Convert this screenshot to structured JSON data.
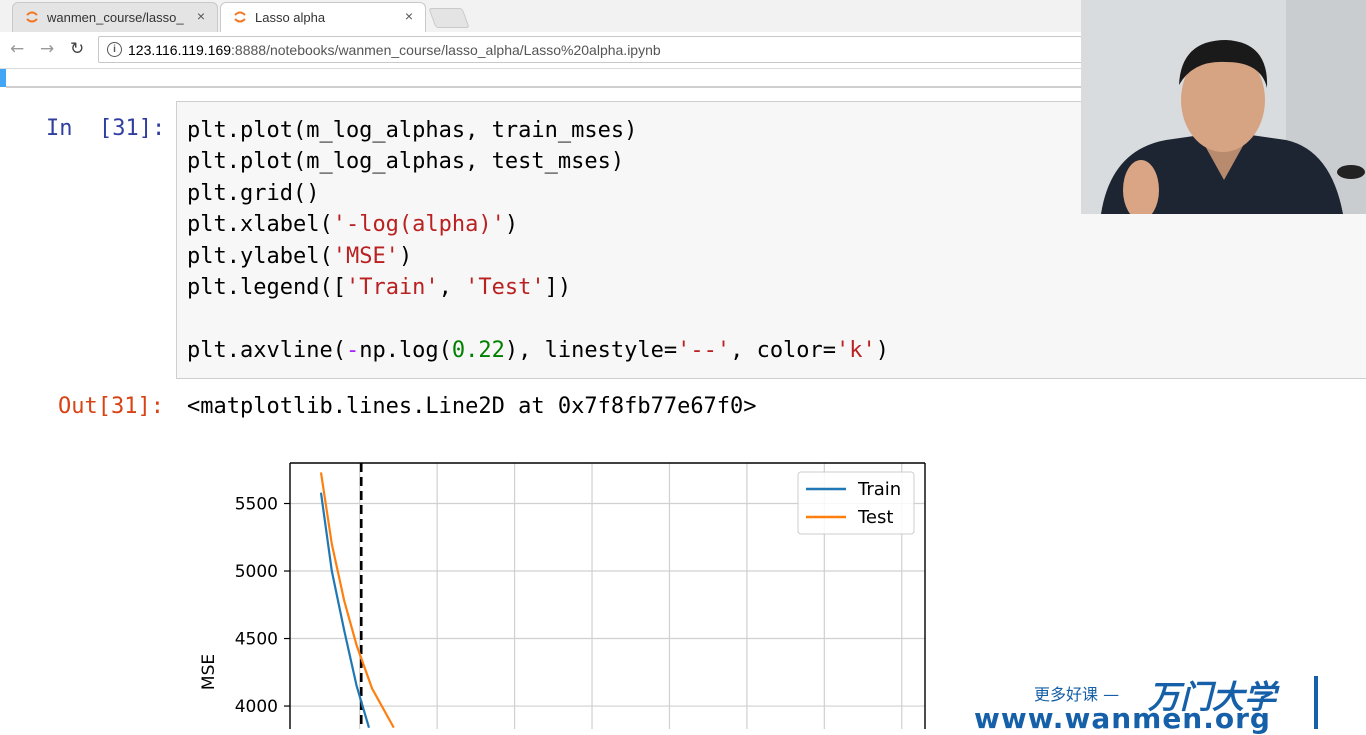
{
  "browser": {
    "tabs": [
      {
        "title": "wanmen_course/lasso_",
        "active": false
      },
      {
        "title": "Lasso alpha",
        "active": true
      }
    ],
    "close_glyph": "×",
    "url_host": "123.116.119.169",
    "url_rest": ":8888/notebooks/wanmen_course/lasso_alpha/Lasso%20alpha.ipynb",
    "nav": {
      "back": "←",
      "forward": "→",
      "reload": "↻"
    }
  },
  "cell": {
    "in_prompt": "In  [31]:",
    "out_prompt": "Out[31]:",
    "output_text": "<matplotlib.lines.Line2D at 0x7f8fb77e67f0>",
    "code": {
      "line1": "plt.plot(m_log_alphas, train_mses)",
      "line2": "plt.plot(m_log_alphas, test_mses)",
      "line3": "plt.grid()",
      "line4_pre": "plt.xlabel(",
      "line4_str": "'-log(alpha)'",
      "line4_post": ")",
      "line5_pre": "plt.ylabel(",
      "line5_str": "'MSE'",
      "line5_post": ")",
      "line6_pre": "plt.legend([",
      "line6_str1": "'Train'",
      "line6_sep": ", ",
      "line6_str2": "'Test'",
      "line6_post": "])",
      "line8_pre": "plt.axvline(",
      "line8_minus": "-",
      "line8_mid": "np.log(",
      "line8_num": "0.22",
      "line8_mid2": "), linestyle=",
      "line8_str1": "'--'",
      "line8_mid3": ", color=",
      "line8_str2": "'k'",
      "line8_post": ")"
    }
  },
  "chart_data": {
    "type": "line",
    "xlabel": "",
    "ylabel": "MSE",
    "ylim_visible": [
      3830,
      5800
    ],
    "yticks": [
      4000,
      4500,
      5000,
      5500
    ],
    "grid": true,
    "legend_position": "top-right",
    "axvline": {
      "x": 1.51,
      "style": "dashed",
      "color": "#000000"
    },
    "xlim": [
      1.05,
      5.15
    ],
    "series": [
      {
        "name": "Train",
        "color": "#1f77b4",
        "x": [
          1.25,
          1.32,
          1.4,
          1.48,
          1.56
        ],
        "y": [
          5580,
          5000,
          4560,
          4150,
          3840
        ]
      },
      {
        "name": "Test",
        "color": "#ff7f0e",
        "x": [
          1.25,
          1.32,
          1.4,
          1.48,
          1.58,
          1.72
        ],
        "y": [
          5730,
          5200,
          4780,
          4450,
          4130,
          3840
        ]
      }
    ]
  },
  "watermark": {
    "slogan": "更多好课 —",
    "brand": "万门大学",
    "site": "www.wanmen.org"
  },
  "colors": {
    "accent": "#42a5f5",
    "in_prompt": "#303f9f",
    "out_prompt": "#d84315",
    "watermark": "#1560a8"
  }
}
